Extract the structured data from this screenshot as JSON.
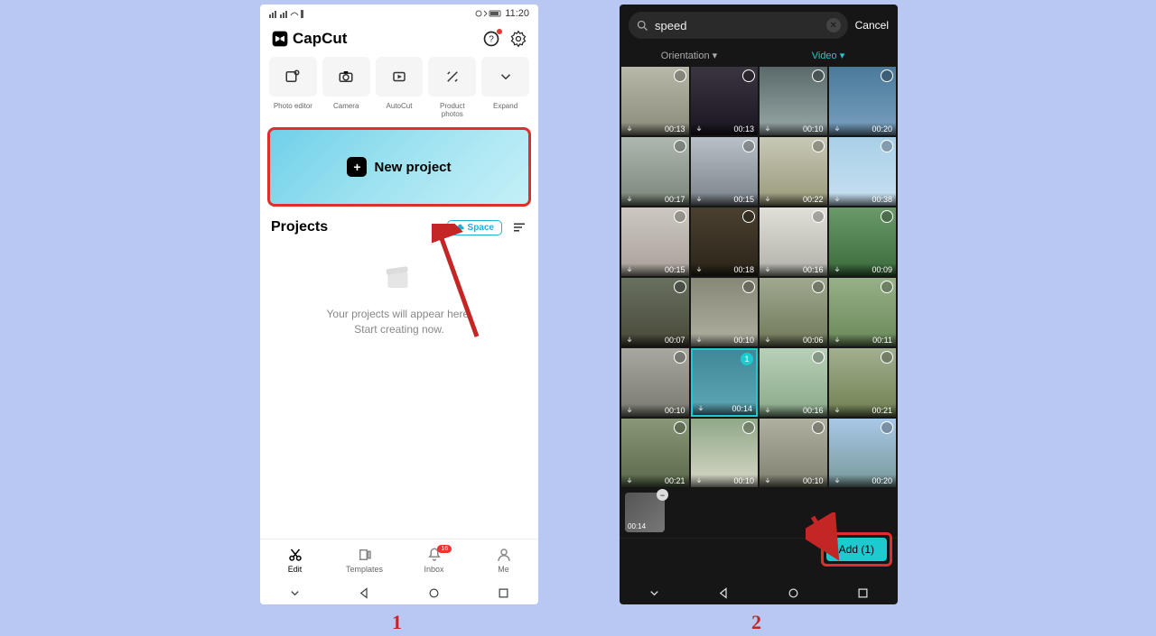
{
  "phone1": {
    "status": {
      "time": "11:20"
    },
    "header": {
      "brand": "CapCut"
    },
    "tools": [
      {
        "label": "Photo editor"
      },
      {
        "label": "Camera"
      },
      {
        "label": "AutoCut"
      },
      {
        "label": "Product photos"
      },
      {
        "label": "Expand"
      }
    ],
    "new_project_label": "New project",
    "projects": {
      "title": "Projects",
      "space_label": "Space",
      "empty_line1": "Your projects will appear here.",
      "empty_line2": "Start creating now."
    },
    "nav": {
      "edit": "Edit",
      "templates": "Templates",
      "inbox": "Inbox",
      "inbox_badge": "16",
      "me": "Me"
    }
  },
  "phone2": {
    "search": {
      "value": "speed",
      "cancel": "Cancel"
    },
    "filters": {
      "orientation": "Orientation",
      "video": "Video"
    },
    "clips": [
      {
        "dur": "00:13",
        "cls": "t0"
      },
      {
        "dur": "00:13",
        "cls": "t1"
      },
      {
        "dur": "00:10",
        "cls": "t2"
      },
      {
        "dur": "00:20",
        "cls": "t3"
      },
      {
        "dur": "00:17",
        "cls": "t4"
      },
      {
        "dur": "00:15",
        "cls": "t5"
      },
      {
        "dur": "00:22",
        "cls": "t6"
      },
      {
        "dur": "00:38",
        "cls": "t7"
      },
      {
        "dur": "00:15",
        "cls": "t8"
      },
      {
        "dur": "00:18",
        "cls": "t9"
      },
      {
        "dur": "00:16",
        "cls": "t10"
      },
      {
        "dur": "00:09",
        "cls": "t11"
      },
      {
        "dur": "00:07",
        "cls": "t12"
      },
      {
        "dur": "00:10",
        "cls": "t13"
      },
      {
        "dur": "00:06",
        "cls": "t14"
      },
      {
        "dur": "00:11",
        "cls": "t15"
      },
      {
        "dur": "00:10",
        "cls": "t16"
      },
      {
        "dur": "00:14",
        "cls": "t17",
        "selected": true,
        "selnum": "1"
      },
      {
        "dur": "00:16",
        "cls": "t18"
      },
      {
        "dur": "00:21",
        "cls": "t19"
      },
      {
        "dur": "00:21",
        "cls": "t20"
      },
      {
        "dur": "00:10",
        "cls": "t21"
      },
      {
        "dur": "00:10",
        "cls": "t22"
      },
      {
        "dur": "00:20",
        "cls": "t23"
      }
    ],
    "tray": {
      "dur": "00:14"
    },
    "add_label": "Add (1)"
  },
  "steps": {
    "one": "1",
    "two": "2"
  }
}
